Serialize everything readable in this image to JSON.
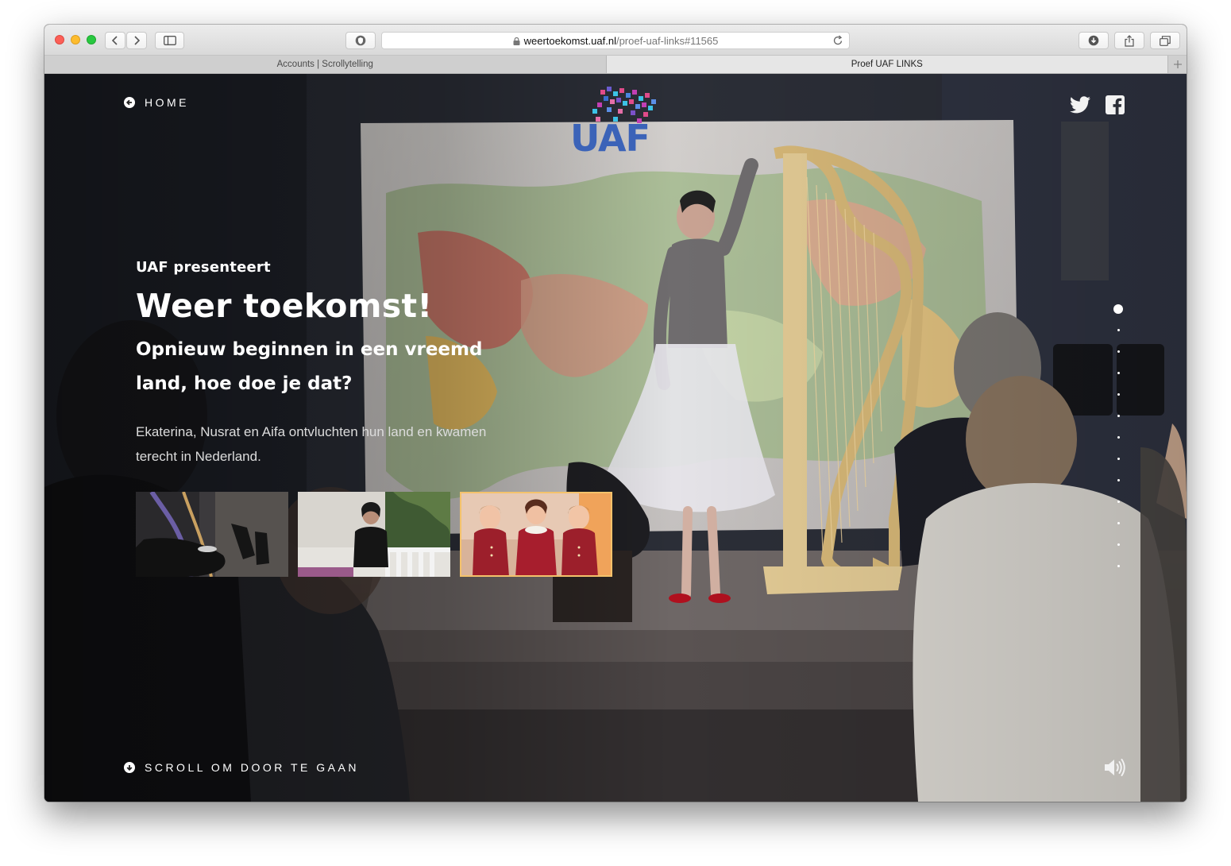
{
  "browser": {
    "url_domain": "weertoekomst.uaf.nl",
    "url_path": "/proef-uaf-links#11565",
    "tabs": [
      {
        "label": "Accounts | Scrollytelling",
        "active": false
      },
      {
        "label": "Proef UAF LINKS",
        "active": true
      }
    ]
  },
  "header": {
    "home_label": "HOME",
    "logo_text": "UAF"
  },
  "hero": {
    "presents": "UAF presenteert",
    "title": "Weer toekomst!",
    "subtitle": "Opnieuw beginnen in een vreemd land, hoe doe je dat?",
    "intro": "Ekaterina, Nusrat en Aifa ontvluchten hun land en kwamen terecht in Nederland.",
    "thumbnails": [
      {
        "name": "harp-shoes",
        "active": false
      },
      {
        "name": "woman-portrait",
        "active": false
      },
      {
        "name": "children-photo",
        "active": true
      }
    ]
  },
  "navigation_dots": {
    "count": 13,
    "active_index": 0
  },
  "footer": {
    "scroll_label": "SCROLL OM DOOR TE GAAN"
  },
  "icons": {
    "home": "arrow-left-circle-icon",
    "scroll": "arrow-down-circle-icon",
    "twitter": "twitter-icon",
    "facebook": "facebook-icon",
    "sound": "speaker-icon"
  },
  "colors": {
    "accent": "#f4c26b",
    "logo_blue": "#3b63b8"
  }
}
